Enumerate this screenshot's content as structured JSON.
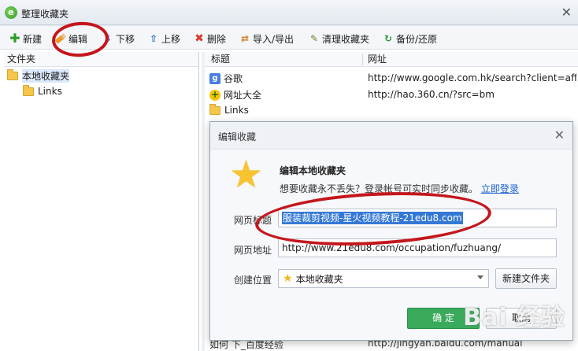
{
  "window": {
    "title": "整理收藏夹",
    "close_glyph": "✕"
  },
  "toolbar": {
    "new_label": "新建",
    "edit_label": "编辑",
    "move_down_label": "下移",
    "move_up_label": "上移",
    "delete_label": "删除",
    "import_export_label": "导入/导出",
    "clean_label": "清理收藏夹",
    "backup_label": "备份/还原"
  },
  "folders": {
    "header": "文件夹",
    "items": [
      {
        "label": "本地收藏夹",
        "selected": true
      },
      {
        "label": "Links",
        "selected": false
      }
    ]
  },
  "list": {
    "col_title": "标题",
    "col_url": "网址",
    "rows": [
      {
        "title": "谷歌",
        "url": "http://www.google.com.hk/search?client=aff-c",
        "icon": "google-icon"
      },
      {
        "title": "网址大全",
        "url": "http://hao.360.cn/?src=bm",
        "icon": "hao360-icon"
      },
      {
        "title": "Links",
        "url": "",
        "icon": "folder-icon"
      }
    ],
    "bottom_row_title": "如何 下_百度经验",
    "bottom_row_url": "http://jingyan.baidu.com/manual"
  },
  "dialog": {
    "title": "编辑收藏",
    "heading": "编辑本地收藏夹",
    "subtitle": "想要收藏永不丢失？登录帐号可实时同步收藏。",
    "login_link": "立即登录",
    "page_title_label": "网页标题",
    "page_title_value": "服装裁剪视频-星火视频教程-21edu8.com",
    "page_url_label": "网页地址",
    "page_url_value": "http://www.21edu8.com/occupation/fuzhuang/",
    "location_label": "创建位置",
    "location_value": "本地收藏夹",
    "new_folder_button": "新建文件夹",
    "ok_button": "确 定",
    "cancel_button": "取消"
  },
  "watermark": "Bai 经验",
  "colors": {
    "accent": "#3aaa5c",
    "annotation": "#c4161c",
    "selection": "#3478d6",
    "link": "#1a5fd0"
  }
}
